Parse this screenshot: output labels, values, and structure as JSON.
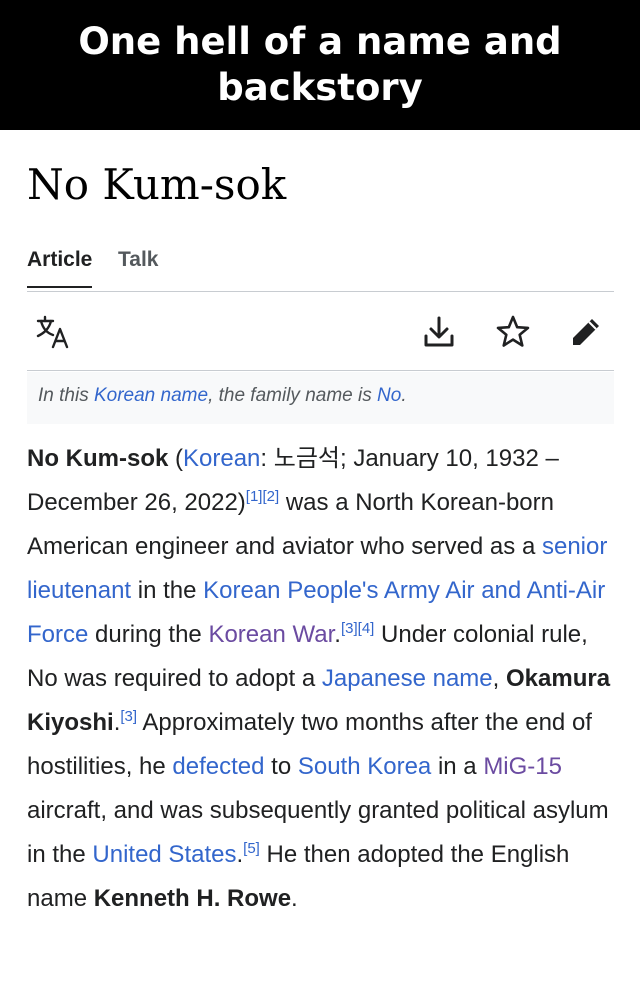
{
  "caption": {
    "line1": "One hell of a name and",
    "line2": "backstory"
  },
  "page": {
    "title": "No Kum-sok"
  },
  "tabs": [
    {
      "label": "Article"
    },
    {
      "label": "Talk"
    }
  ],
  "toolbar": {
    "icons": [
      "language-icon",
      "download-icon",
      "star-icon",
      "edit-icon"
    ]
  },
  "notice": {
    "pre": "In this ",
    "link": "Korean name",
    "mid": ", the family name is ",
    "link2": "No",
    "post": "."
  },
  "article": {
    "s1_bold": "No Kum-sok",
    "s1_open": " (",
    "s1_korean_link": "Korean",
    "s1_hangul": ": 노금석; January 10, 1932 – December 26, 2022)",
    "ref_1": "[1]",
    "ref_2": "[2]",
    "s1_rest": " was a North Korean-born American engineer and aviator who served as a ",
    "link_senior_lt": "senior lieutenant",
    "s1_in_the": " in the ",
    "link_kpaf": "Korean People's Army Air and Anti-Air Force",
    "s1_during": " during the ",
    "link_korean_war": "Korean War",
    "s1_dot": ".",
    "ref_3": "[3]",
    "ref_4": "[4]",
    "s2_start": " Under colonial rule, No was required to adopt a ",
    "link_japanese_name": "Japanese name",
    "s2_comma": ", ",
    "s2_bold": "Okamura Kiyoshi",
    "s2_dot": ".",
    "ref_3b": "[3]",
    "s3_start": " Approximately two months after the end of hostilities, he ",
    "link_defected": "defected",
    "s3_to": " to ",
    "link_south_korea": "South Korea",
    "s3_in_a": " in a ",
    "link_mig15": "MiG-15",
    "s3_rest": " aircraft, and was subsequently granted political asylum in the ",
    "link_us": "United States",
    "s3_dot": ".",
    "ref_5": "[5]",
    "s4_start": " He then adopted the English name ",
    "s4_bold": "Kenneth H. Rowe",
    "s4_dot": "."
  },
  "colors": {
    "link": "#3366cc",
    "visited_link": "#6b4ba1",
    "text": "#202122",
    "caption_bg": "#000000"
  }
}
